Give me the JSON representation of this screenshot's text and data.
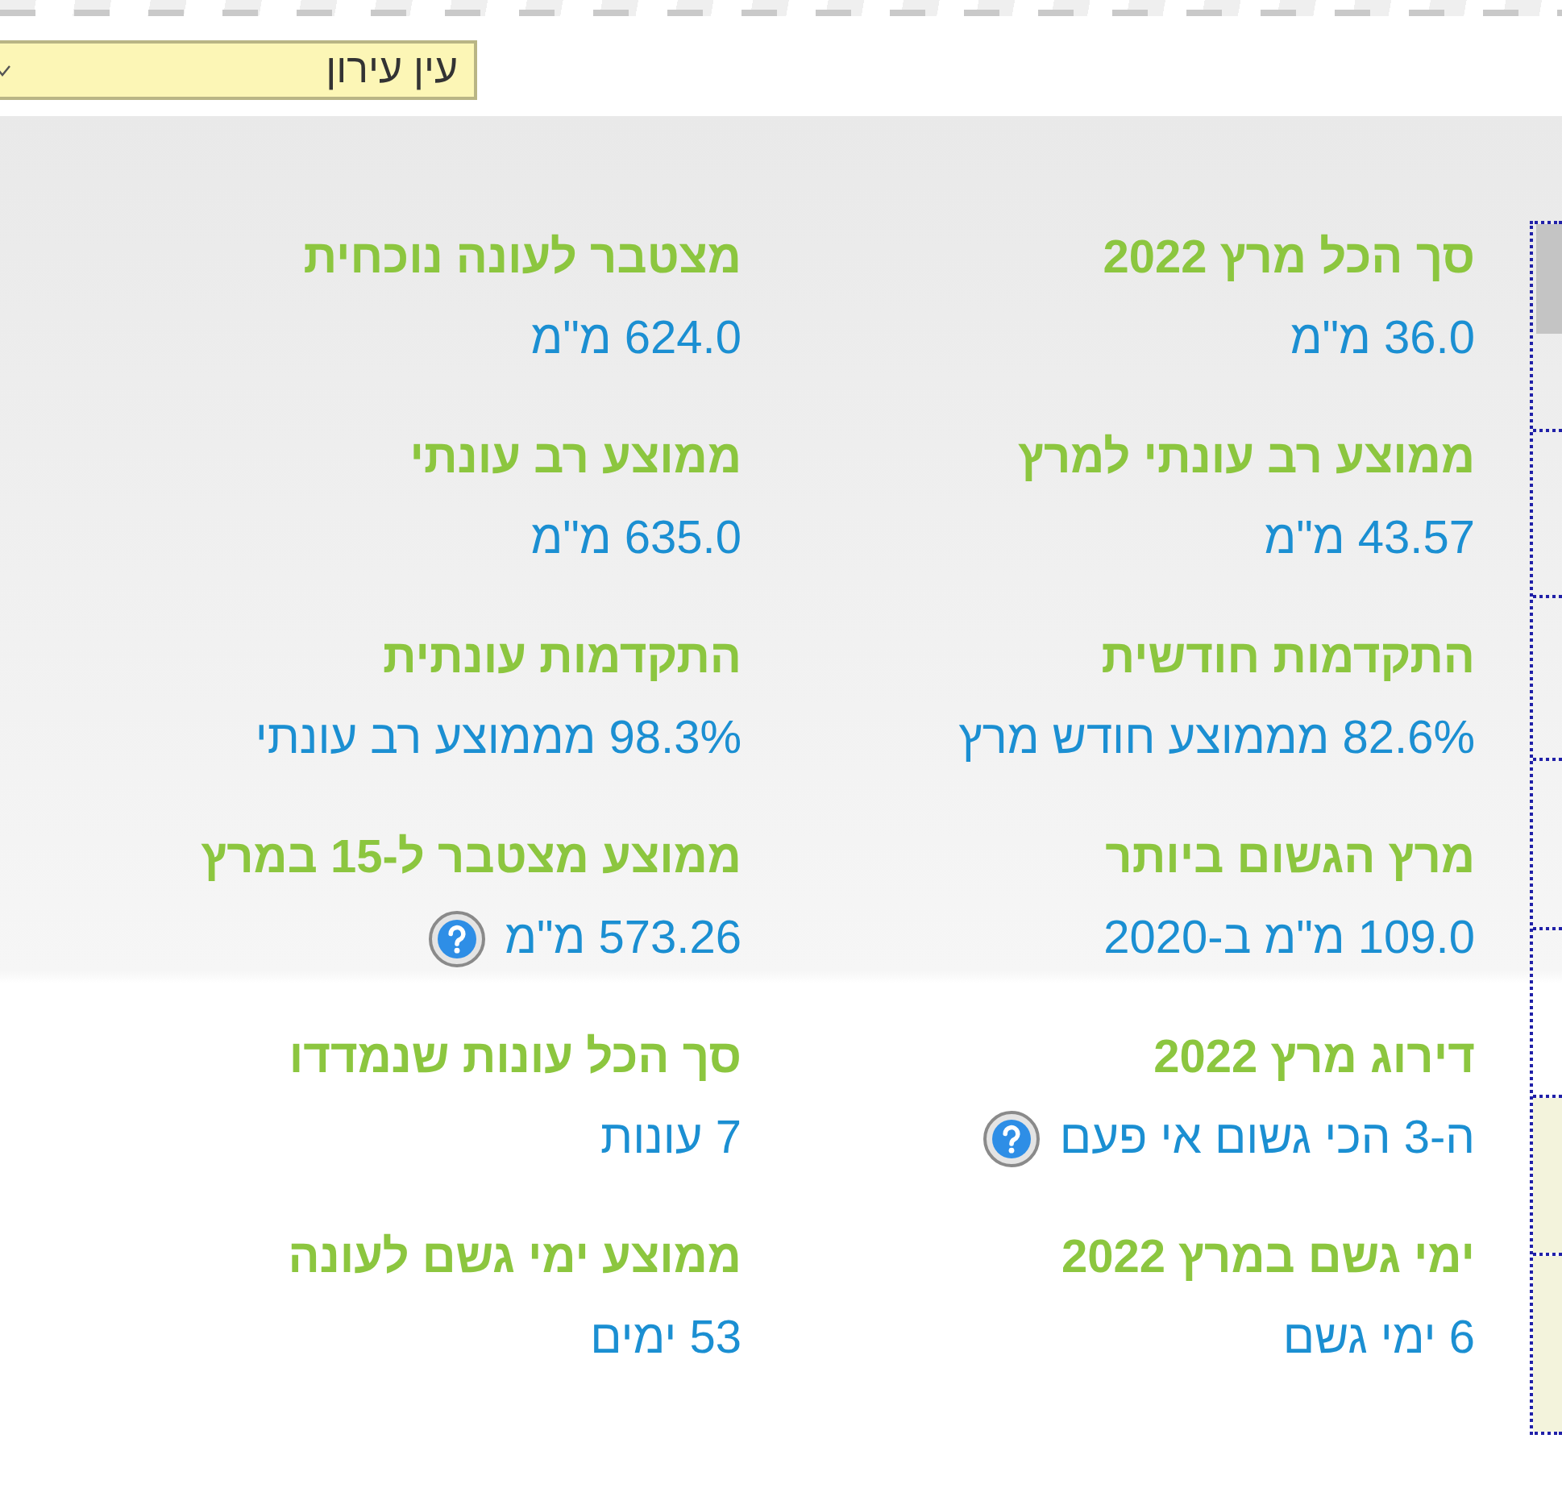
{
  "location_select": {
    "value": "עין עירון"
  },
  "stats": [
    {
      "label": "סך הכל מרץ 2022",
      "value": "36.0 מ\"מ",
      "help": false
    },
    {
      "label": "מצטבר לעונה נוכחית",
      "value": "624.0 מ\"מ",
      "help": false
    },
    {
      "label": "ממוצע רב עונתי למרץ",
      "value": "43.57 מ\"מ",
      "help": false
    },
    {
      "label": "ממוצע רב עונתי",
      "value": "635.0 מ\"מ",
      "help": false
    },
    {
      "label": "התקדמות חודשית",
      "value": "82.6% מממוצע חודש מרץ",
      "help": false
    },
    {
      "label": "התקדמות עונתית",
      "value": "98.3% מממוצע רב עונתי",
      "help": false
    },
    {
      "label": "מרץ הגשום ביותר",
      "value": "109.0 מ\"מ ב-2020",
      "help": false
    },
    {
      "label": "ממוצע מצטבר ל-15 במרץ",
      "value": "573.26 מ\"מ",
      "help": true
    },
    {
      "label": "דירוג מרץ 2022",
      "value": "ה-3 הכי גשום אי פעם",
      "help": true
    },
    {
      "label": "סך הכל עונות שנמדדו",
      "value": "7 עונות",
      "help": false
    },
    {
      "label": "ימי גשם במרץ 2022",
      "value": "6 ימי גשם",
      "help": false
    },
    {
      "label": "ממוצע ימי גשם לעונה",
      "value": "53 ימים",
      "help": false
    }
  ]
}
